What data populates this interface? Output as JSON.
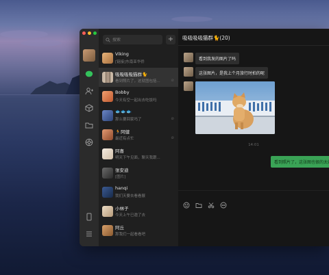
{
  "search": {
    "placeholder": "搜索"
  },
  "chat_title": "吸吸吸吸猫群🐈(20)",
  "colors": {
    "accent": "#3aa356",
    "bg": "#161616"
  },
  "nav": [
    "chat-icon",
    "contacts-icon",
    "box-icon",
    "folder-icon",
    "moments-icon",
    "phone-icon",
    "menu-icon"
  ],
  "chats": [
    {
      "name": "Viking",
      "preview": "[链接]东南亚华侨",
      "time": "",
      "avatar": "#d9a06a"
    },
    {
      "name": "吸吸吸吸猫群🐈",
      "preview": "看到照片了，这就图包括...",
      "time": "",
      "avatar": "#9c8f84",
      "muted": true
    },
    {
      "name": "Bobby",
      "preview": "今天有空一起出去吃饭吗",
      "time": "",
      "avatar": "#e38a5b"
    },
    {
      "name": "🐟🐟🐟",
      "preview": "那么要回家吗了",
      "time": "",
      "avatar": "#4a67a6",
      "muted": true
    },
    {
      "name": "🏃阿健",
      "preview": "最近有点忙",
      "time": "",
      "avatar": "#c76c45",
      "muted": true
    },
    {
      "name": "阿喜",
      "preview": "明天下午见面，聊天我跟...",
      "time": "",
      "avatar": "#efe3d4"
    },
    {
      "name": "张安迪",
      "preview": "[图片]",
      "time": "",
      "avatar": "#4f4f4f"
    },
    {
      "name": "hanqi",
      "preview": "我们天要去看看展",
      "time": "",
      "avatar": "#27406e"
    },
    {
      "name": "小林子",
      "preview": "今天上午已邀了去",
      "time": "",
      "avatar": "#e0cbb0"
    },
    {
      "name": "阿丘",
      "preview": "那我们一起看看吧",
      "time": "",
      "avatar": "#c58e5a"
    }
  ],
  "messages": [
    {
      "text": "看到我发的图片了吗"
    },
    {
      "text": "这张图片，是我上个月旅行时拍的呢"
    }
  ],
  "timestamp": "14:01",
  "my_message": "看到照片了，这张图也很的太好",
  "composer_tools": [
    "emoji-icon",
    "folder-icon",
    "scissors-icon",
    "chat-bubble-icon"
  ]
}
